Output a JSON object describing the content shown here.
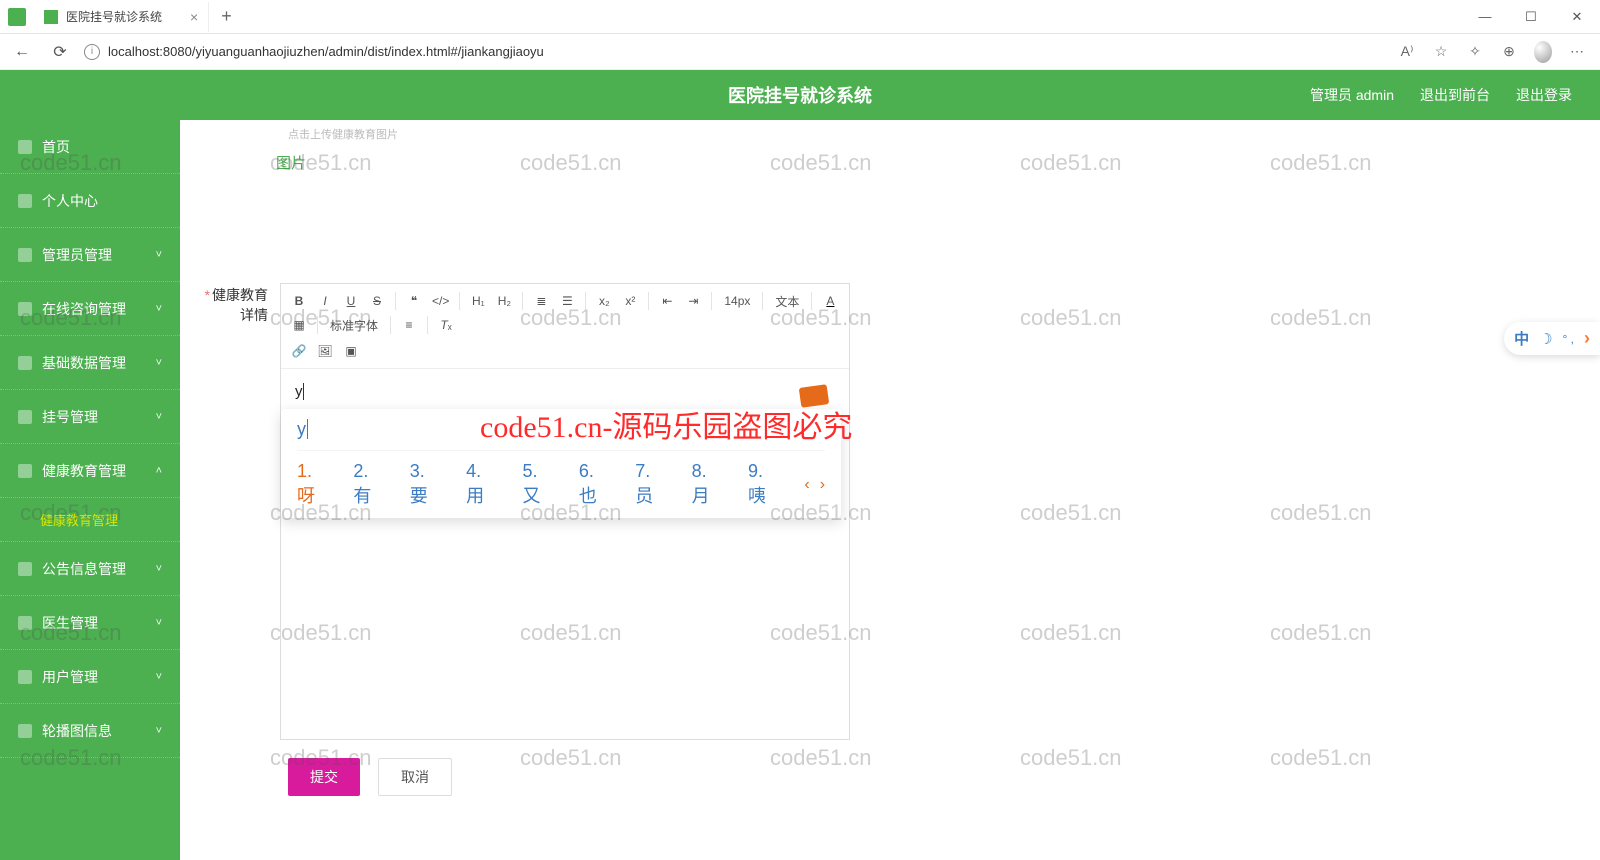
{
  "browser": {
    "tab_title": "医院挂号就诊系统",
    "url": "localhost:8080/yiyuanguanhaojiuzhen/admin/dist/index.html#/jiankangjiaoyu",
    "win_min": "—",
    "win_max": "☐",
    "win_close": "✕"
  },
  "header": {
    "title": "医院挂号就诊系统",
    "user_label": "管理员 admin",
    "exit_front": "退出到前台",
    "logout": "退出登录"
  },
  "sidebar": {
    "items": [
      {
        "label": "首页",
        "chev": ""
      },
      {
        "label": "个人中心",
        "chev": ""
      },
      {
        "label": "管理员管理",
        "chev": "˅"
      },
      {
        "label": "在线咨询管理",
        "chev": "˅"
      },
      {
        "label": "基础数据管理",
        "chev": "˅"
      },
      {
        "label": "挂号管理",
        "chev": "˅"
      },
      {
        "label": "健康教育管理",
        "chev": "˄"
      },
      {
        "label": "公告信息管理",
        "chev": "˅"
      },
      {
        "label": "医生管理",
        "chev": "˅"
      },
      {
        "label": "用户管理",
        "chev": "˅"
      },
      {
        "label": "轮播图信息",
        "chev": "˅"
      }
    ],
    "sub_active": "健康教育管理"
  },
  "form": {
    "img_tip_top": "点击上传健康教育图片",
    "img_label": "图片",
    "detail_label": "健康教育详情",
    "req": "*",
    "submit": "提交",
    "cancel": "取消"
  },
  "editor": {
    "font_size": "14px",
    "font_type": "文本",
    "font_family": "标准字体",
    "typed": "y"
  },
  "ime": {
    "pinyin": "y",
    "candidates": [
      {
        "n": "1.",
        "w": "呀"
      },
      {
        "n": "2.",
        "w": "有"
      },
      {
        "n": "3.",
        "w": "要"
      },
      {
        "n": "4.",
        "w": "用"
      },
      {
        "n": "5.",
        "w": "又"
      },
      {
        "n": "6.",
        "w": "也"
      },
      {
        "n": "7.",
        "w": "员"
      },
      {
        "n": "8.",
        "w": "月"
      },
      {
        "n": "9.",
        "w": "咦"
      }
    ],
    "page_prev": "‹",
    "page_next": "›",
    "tab_cn": "中",
    "tab_moon": "☽",
    "tab_dots": "° ,",
    "tab_arrow": "›"
  },
  "watermark": {
    "text": "code51.cn",
    "red": "code51.cn-源码乐园盗图必究"
  }
}
